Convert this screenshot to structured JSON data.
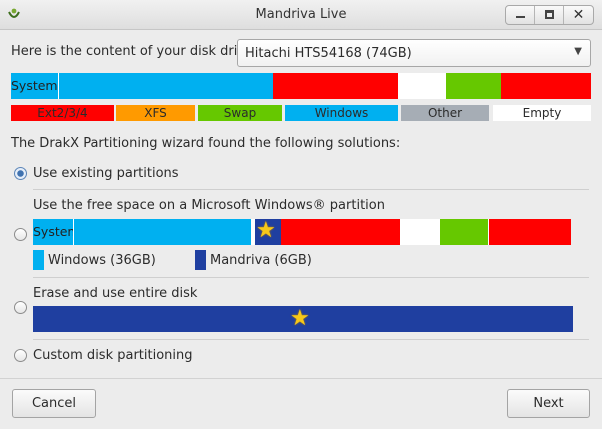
{
  "window": {
    "title": "Mandriva Live",
    "controls": {
      "minimize_icon": "minimize-icon",
      "maximize_icon": "maximize-icon",
      "close_label": "✕"
    }
  },
  "drive": {
    "label": "Here is the content of your disk drive",
    "selected": "Hitachi HTS54168 (74GB)",
    "arrow": "▼"
  },
  "disk_bar": {
    "system_label": "System",
    "segments_colors": [
      "#00b0f0",
      "#00b0f0",
      "#ff0000",
      "#ffffff",
      "#66c800",
      "#ff0000"
    ]
  },
  "legend": {
    "items": [
      {
        "label": "Ext2/3/4",
        "color": "#ff0000"
      },
      {
        "label": "XFS",
        "color": "#ff9a00"
      },
      {
        "label": "Swap",
        "color": "#66c800"
      },
      {
        "label": "Windows",
        "color": "#00b0f0"
      },
      {
        "label": "Other",
        "color": "#a6adb5"
      },
      {
        "label": "Empty",
        "color": "#ffffff"
      }
    ]
  },
  "wizard": {
    "found_text": "The DrakX Partitioning wizard found the following solutions:",
    "options": {
      "existing": "Use existing partitions",
      "free_space": "Use the free space on a Microsoft Windows® partition",
      "free_space_bar_label": "System",
      "windows_size": "Windows (36GB)",
      "mandriva_size": "Mandriva (6GB)",
      "erase": "Erase and use entire disk",
      "custom": "Custom disk partitioning"
    },
    "selected_option": "existing"
  },
  "colors": {
    "windows": "#00b0f0",
    "mandriva": "#1f3fa0",
    "linux": "#ff0000",
    "swap": "#66c800",
    "star": "#f6c81a"
  },
  "buttons": {
    "cancel": "Cancel",
    "next": "Next"
  }
}
